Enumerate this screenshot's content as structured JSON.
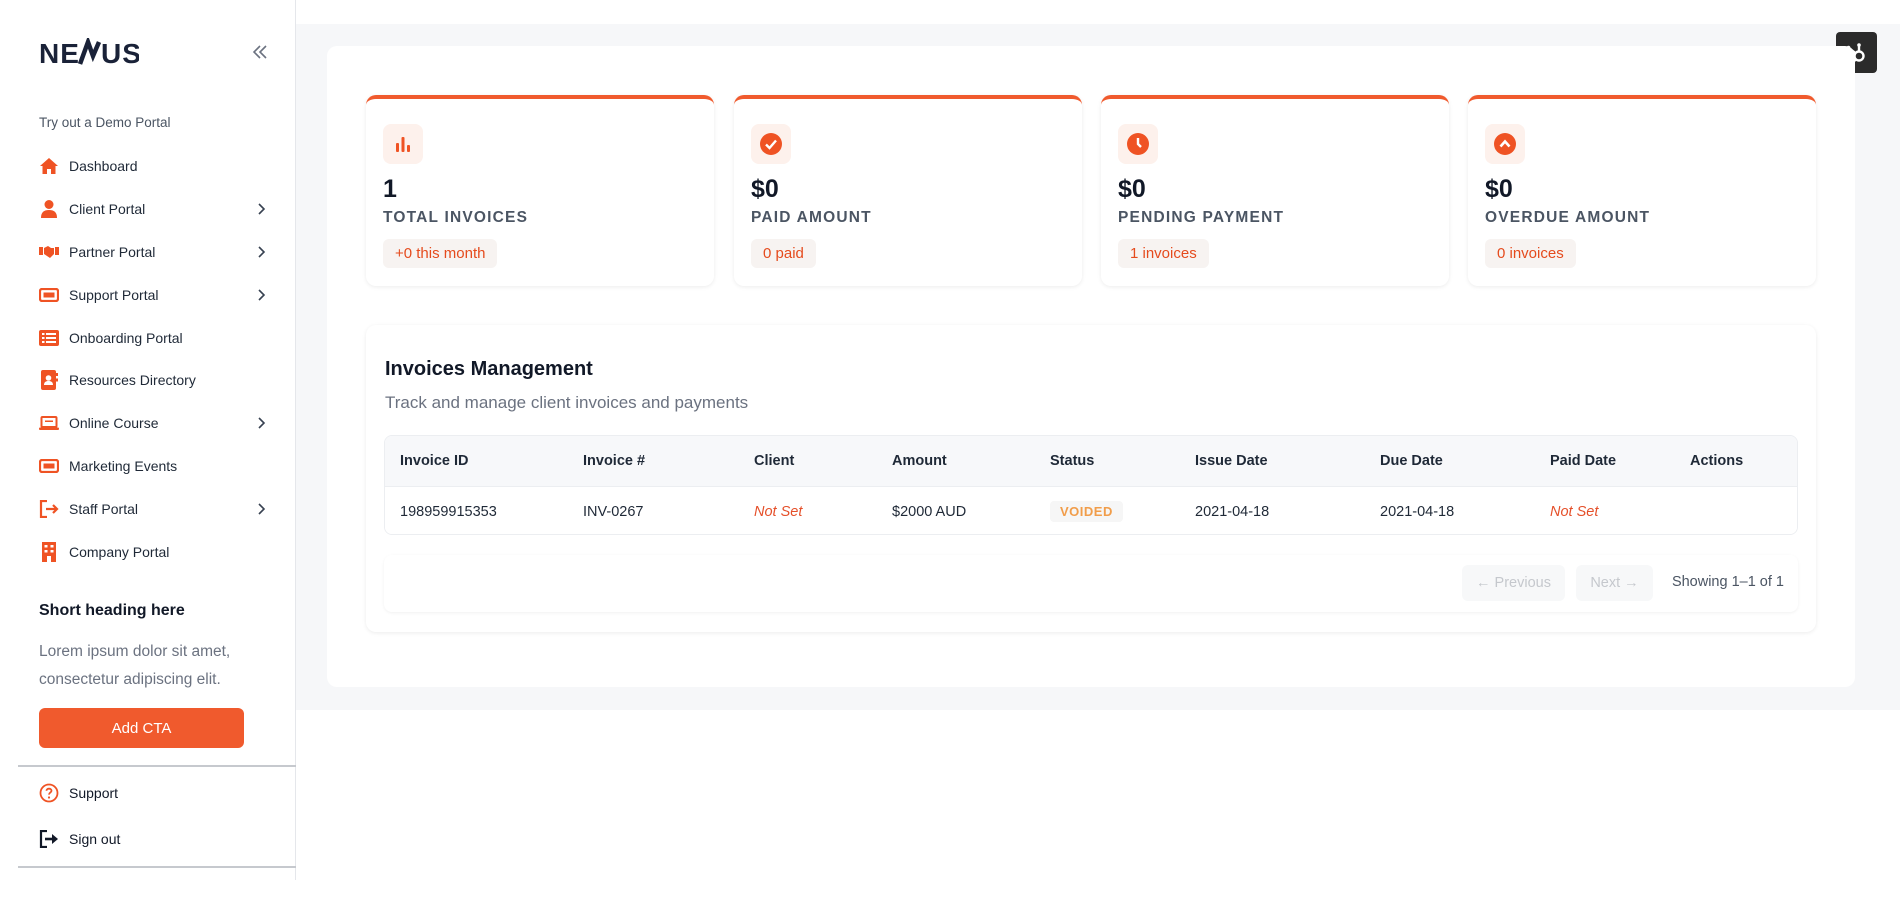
{
  "brand": {
    "logo_text": "NEXUS"
  },
  "sidebar": {
    "demo_label": "Try out a Demo Portal",
    "items": [
      {
        "label": "Dashboard",
        "icon": "home-icon",
        "has_chevron": false
      },
      {
        "label": "Client Portal",
        "icon": "user-icon",
        "has_chevron": true
      },
      {
        "label": "Partner Portal",
        "icon": "handshake-icon",
        "has_chevron": true
      },
      {
        "label": "Support Portal",
        "icon": "ticket-icon",
        "has_chevron": true
      },
      {
        "label": "Onboarding Portal",
        "icon": "list-icon",
        "has_chevron": false
      },
      {
        "label": "Resources Directory",
        "icon": "address-book-icon",
        "has_chevron": false
      },
      {
        "label": "Online Course",
        "icon": "laptop-icon",
        "has_chevron": true
      },
      {
        "label": "Marketing Events",
        "icon": "ticket-icon",
        "has_chevron": false
      },
      {
        "label": "Staff Portal",
        "icon": "door-arrow-icon",
        "has_chevron": true
      },
      {
        "label": "Company Portal",
        "icon": "building-icon",
        "has_chevron": false
      }
    ],
    "promo": {
      "heading": "Short heading here",
      "text": "Lorem ipsum dolor sit amet, consectetur adipiscing elit.",
      "cta_label": "Add CTA"
    },
    "support_label": "Support",
    "signout_label": "Sign out"
  },
  "stats": [
    {
      "value": "1",
      "label": "TOTAL INVOICES",
      "badge": "+0 this month",
      "icon": "bar-chart-icon"
    },
    {
      "value": "$0",
      "label": "PAID AMOUNT",
      "badge": "0 paid",
      "icon": "check-circle-icon"
    },
    {
      "value": "$0",
      "label": "PENDING PAYMENT",
      "badge": "1 invoices",
      "icon": "clock-icon"
    },
    {
      "value": "$0",
      "label": "OVERDUE AMOUNT",
      "badge": "0 invoices",
      "icon": "chevron-up-circle-icon"
    }
  ],
  "invoices": {
    "title": "Invoices Management",
    "subtitle": "Track and manage client invoices and payments",
    "columns": [
      "Invoice ID",
      "Invoice #",
      "Client",
      "Amount",
      "Status",
      "Issue Date",
      "Due Date",
      "Paid Date",
      "Actions"
    ],
    "rows": [
      {
        "invoice_id": "198959915353",
        "invoice_no": "INV-0267",
        "client": "Not Set",
        "amount": "$2000 AUD",
        "status": "VOIDED",
        "issue_date": "2021-04-18",
        "due_date": "2021-04-18",
        "paid_date": "Not Set",
        "actions": ""
      }
    ],
    "pagination": {
      "previous_label": "← Previous",
      "next_label": "Next →",
      "showing": "Showing 1–1 of 1"
    }
  },
  "colors": {
    "accent": "#f05a2d",
    "voided": "#f19d4a",
    "not_set": "#e5502a"
  }
}
